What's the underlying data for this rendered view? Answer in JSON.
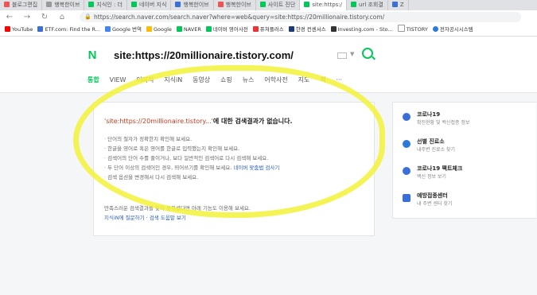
{
  "browser": {
    "tabs": [
      {
        "label": "블로그편집"
      },
      {
        "label": "행복한이브"
      },
      {
        "label": "지식인 : 더"
      },
      {
        "label": "네이버 지식"
      },
      {
        "label": "행복한이브"
      },
      {
        "label": "행복한이브"
      },
      {
        "label": "사이트 진단"
      },
      {
        "label": "site:https:/",
        "active": true
      },
      {
        "label": "url 조회결"
      },
      {
        "label": "Z"
      }
    ],
    "url": "https://search.naver.com/search.naver?where=web&query=site:https://20millionaire.tistory.com/",
    "bookmarks": [
      "YouTube",
      "ETF.com: Find the R...",
      "Google 번역",
      "Google",
      "NAVER",
      "네이버 영어사전",
      "퓨쳐플러스",
      "한경 컨센서스",
      "Investing.com - Sto...",
      "TISTORY",
      "전자공시시스템"
    ]
  },
  "search": {
    "logo": "N",
    "query": "site:https://20millionaire.tistory.com/",
    "tabs": [
      "통합",
      "VIEW",
      "이미지",
      "지식iN",
      "동영상",
      "쇼핑",
      "뉴스",
      "어학사전",
      "지도",
      "책",
      "···"
    ]
  },
  "result": {
    "query_quoted": "'site:https://20millionaire.tistory...'",
    "title_suffix": "에 대한 검색결과가 없습니다.",
    "tips": [
      "단어의 철자가 정확한지 확인해 보세요.",
      "한글을 영어로 혹은 영어를 한글로 입력했는지 확인해 보세요.",
      "검색어의 단어 수를 줄이거나, 보다 일반적인 검색어로 다시 검색해 보세요.",
      "두 단어 이상의 검색어인 경우, 띄어쓰기를 확인해 보세요.",
      "검색 옵션을 변경해서 다시 검색해 보세요."
    ],
    "tip_link": "네이버 맞춤법 검사기",
    "footer_note": "만족스러운 검색결과를 찾지 못하셨다면 아래 기능도 이용해 보세요.",
    "footer_link_1": "지식iN에 질문하기",
    "footer_link_2": "검색 도움말 보기"
  },
  "sidebar": {
    "items": [
      {
        "title": "코로나19",
        "sub": "확진현황 및 백신접종 정보"
      },
      {
        "title": "선별 진료소",
        "sub": "내주변 진료소 찾기"
      },
      {
        "title": "코로나19 팩트체크",
        "sub": "백신 정보 보기"
      },
      {
        "title": "예방접종센터",
        "sub": "내 주변 센터 찾기"
      }
    ]
  }
}
